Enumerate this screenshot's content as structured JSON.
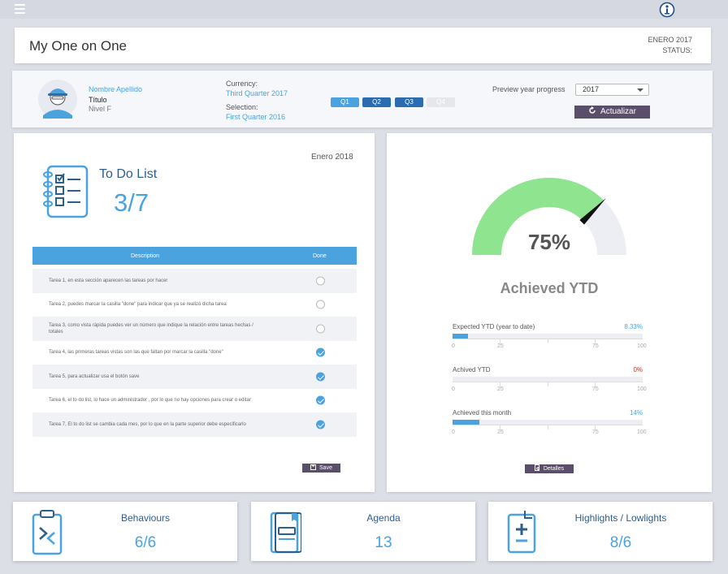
{
  "header": {
    "menu_icon": "hamburger-menu-icon",
    "logo_icon": "info-logo-icon"
  },
  "title_bar": {
    "title": "My One on One",
    "date": "ENERO 2017",
    "status": "STATUS:"
  },
  "profile": {
    "name": "Nombre Apellido",
    "title": "Título",
    "level": "Nivel F",
    "currency_label": "Currency:",
    "currency_value": "Third Quarter 2017",
    "selection_label": "Selection:",
    "selection_value": "First Quarter 2016",
    "quarters": [
      "Q1",
      "Q2",
      "Q3",
      "Q4"
    ],
    "preview_label": "Preview year progress",
    "preview_year": "2017",
    "refresh_label": "Actualizar"
  },
  "todo": {
    "date": "Enero 2018",
    "title": "To Do List",
    "count": "3/7",
    "col_description": "Description",
    "col_done": "Done",
    "tasks": [
      {
        "text": "Tarea 1, en esta sección aparecen las tareas por hacer",
        "done": false
      },
      {
        "text": "Tarea 2, puedes marcar la casilla \"done\" para indicar que ya se realizó dicha tarea",
        "done": false
      },
      {
        "text": "Tarea 3, como vista rápida puedes ver un número que indique la relación entre tareas hechas / totales",
        "done": false
      },
      {
        "text": "Tarea 4, las primeras tareas vistas son las que faltan por marcar la casilla \"done\"",
        "done": true
      },
      {
        "text": "Tarea 5, para actualizar usa el botón save",
        "done": true
      },
      {
        "text": "Tarea 6, el to do list, lo hace un administrador , por lo que no hay opciones para crear o editar",
        "done": true
      },
      {
        "text": "Tarea 7, El to do list se cambia  cada mes, por lo que en la parte superior debe especificarlo",
        "done": true
      }
    ],
    "save_label": "Save"
  },
  "gauge": {
    "value": 75,
    "value_label": "75%",
    "title": "Achieved YTD",
    "color_fill": "#8ee48f",
    "color_track": "#eceef3",
    "metrics": [
      {
        "label": "Expected YTD (year to date)",
        "value_label": "8.33%",
        "value": 8.33,
        "color": "#4aa3df"
      },
      {
        "label": "Achived YTD",
        "value_label": "0%",
        "value": 0,
        "color": "#c03a2b"
      },
      {
        "label": "Achieved this month",
        "value_label": "14%",
        "value": 14,
        "color": "#4aa3df"
      }
    ],
    "axis_ticks": [
      "0",
      "25",
      "75",
      "100"
    ],
    "details_label": "Detalles"
  },
  "summary": [
    {
      "title": "Behaviours",
      "value": "6/6",
      "icon": "clipboard-arrows-icon"
    },
    {
      "title": "Agenda",
      "value": "13",
      "icon": "notebook-icon"
    },
    {
      "title": "Highlights / Lowlights",
      "value": "8/6",
      "icon": "clipboard-plus-minus-icon"
    }
  ]
}
